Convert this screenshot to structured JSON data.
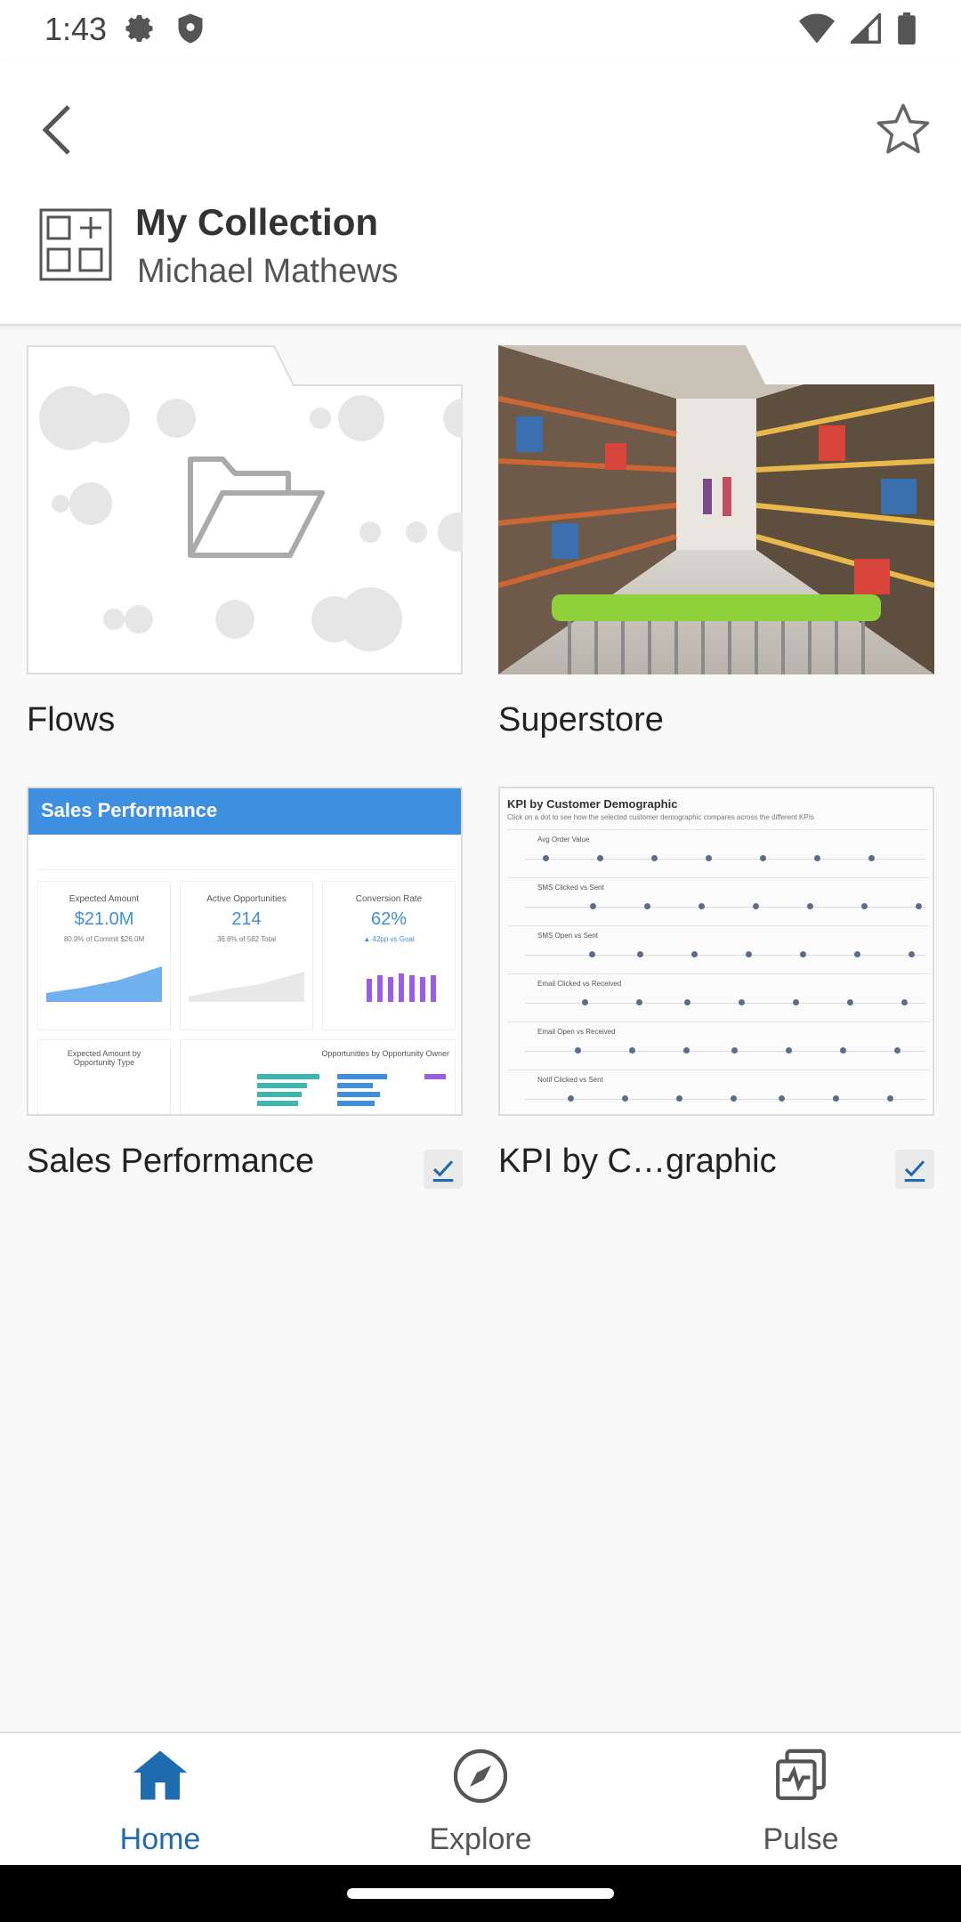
{
  "status_bar": {
    "time": "1:43"
  },
  "header": {
    "title": "My Collection",
    "owner": "Michael Mathews"
  },
  "items": [
    {
      "label": "Flows"
    },
    {
      "label": "Superstore"
    },
    {
      "label": "Sales Performance",
      "thumb": {
        "title": "Sales Performance",
        "kpis": [
          {
            "name": "Expected Amount",
            "value": "$21.0M",
            "sub": "80.9% of Commit $26.0M"
          },
          {
            "name": "Active Opportunities",
            "value": "214",
            "sub": "36.8% of 582 Total"
          },
          {
            "name": "Conversion Rate",
            "value": "62%",
            "sub": "▲ 42pp vs Goal"
          }
        ],
        "bottom_left": "Expected Amount by Opportunity Type",
        "bottom_right": "Opportunities by Opportunity Owner"
      }
    },
    {
      "label": "KPI by C…graphic",
      "thumb": {
        "title": "KPI by Customer Demographic",
        "subtitle": "Click on a dot to see how the selected customer demographic compares across the different KPIs",
        "rows": [
          "Avg Order Value",
          "SMS Clicked vs Sent",
          "SMS Open vs Sent",
          "Email Clicked vs Received",
          "Email Open vs Received",
          "Notif Clicked vs Sent"
        ]
      }
    }
  ],
  "nav": [
    {
      "label": "Home"
    },
    {
      "label": "Explore"
    },
    {
      "label": "Pulse"
    }
  ],
  "colors": {
    "accent": "#1f6bb0",
    "sales_header": "#3d8fe0"
  }
}
